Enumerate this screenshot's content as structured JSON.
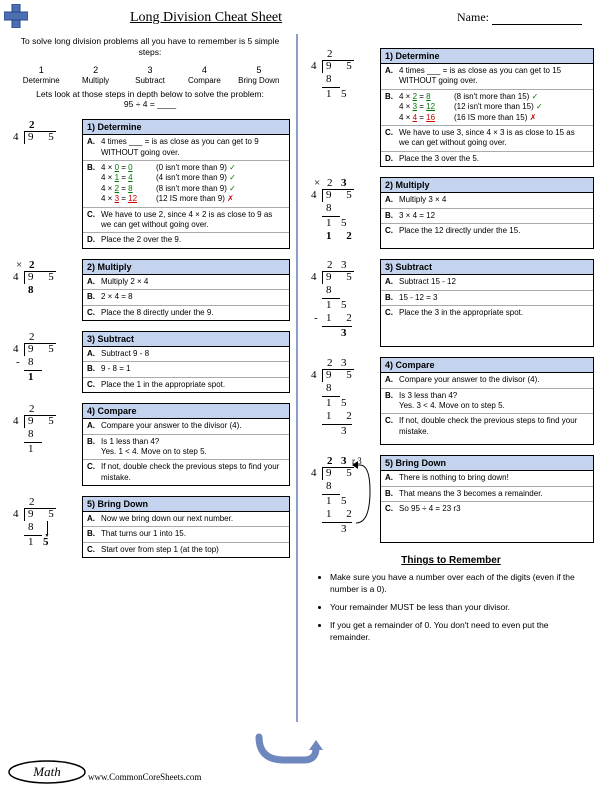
{
  "header": {
    "title": "Long Division Cheat Sheet",
    "name_label": "Name:"
  },
  "intro": {
    "line1": "To solve long division problems all you have to remember is 5 simple steps:",
    "steps": [
      {
        "n": "1",
        "t": "Determine"
      },
      {
        "n": "2",
        "t": "Multiply"
      },
      {
        "n": "3",
        "t": "Subtract"
      },
      {
        "n": "4",
        "t": "Compare"
      },
      {
        "n": "5",
        "t": "Bring Down"
      }
    ],
    "example_prefix": "Lets look at those steps in depth below to solve the problem:",
    "example_problem": "95 ÷ 4 = ____"
  },
  "left_steps": [
    {
      "hdr": "1) Determine",
      "lines": [
        {
          "lbl": "A.",
          "txt": "4 times ___ = is as close as you can get to 9 WITHOUT going over."
        },
        {
          "lbl": "B.",
          "html": [
            {
              "lhs": "4 × ",
              "u": "0",
              "mid": " = ",
              "v": "0",
              "note": "(0 isn't more than 9)",
              "cls": "ok",
              "mark": "✓"
            },
            {
              "lhs": "4 × ",
              "u": "1",
              "mid": " = ",
              "v": "4",
              "note": "(4 isn't more than 9)",
              "cls": "ok",
              "mark": "✓"
            },
            {
              "lhs": "4 × ",
              "u": "2",
              "mid": " = ",
              "v": "8",
              "note": "(8 isn't more than 9)",
              "cls": "ok",
              "mark": "✓"
            },
            {
              "lhs": "4 × ",
              "u": "3",
              "mid": " = ",
              "v": "12",
              "note": "(12 IS more than 9)",
              "cls": "bad",
              "mark": "✗"
            }
          ]
        },
        {
          "lbl": "C.",
          "txt": "We have to use 2, since 4 × 2 is as close to 9 as we can get without going over."
        },
        {
          "lbl": "D.",
          "txt": "Place the 2 over the 9."
        }
      ]
    },
    {
      "hdr": "2) Multiply",
      "lines": [
        {
          "lbl": "A.",
          "txt": "Multiply 2 × 4"
        },
        {
          "lbl": "B.",
          "txt": "2 × 4 = 8"
        },
        {
          "lbl": "C.",
          "txt": "Place the 8 directly under the 9."
        }
      ]
    },
    {
      "hdr": "3) Subtract",
      "lines": [
        {
          "lbl": "A.",
          "txt": "Subtract 9 - 8"
        },
        {
          "lbl": "B.",
          "txt": "9 - 8 = 1"
        },
        {
          "lbl": "C.",
          "txt": "Place the 1 in the appropriate spot."
        }
      ]
    },
    {
      "hdr": "4) Compare",
      "lines": [
        {
          "lbl": "A.",
          "txt": "Compare your answer to the divisor (4)."
        },
        {
          "lbl": "B.",
          "txt": "Is 1 less than 4?\nYes. 1 < 4. Move on to step 5."
        },
        {
          "lbl": "C.",
          "txt": "If not, double check the previous steps to find your mistake."
        }
      ]
    },
    {
      "hdr": "5) Bring Down",
      "lines": [
        {
          "lbl": "A.",
          "txt": "Now we bring down our next number."
        },
        {
          "lbl": "B.",
          "txt": "That turns our 1 into 15."
        },
        {
          "lbl": "C.",
          "txt": "Start over from step 1 (at the top)"
        }
      ]
    }
  ],
  "right_steps": [
    {
      "hdr": "1) Determine",
      "lines": [
        {
          "lbl": "A.",
          "txt": "4 times ___ = is as close as you can get to 15 WITHOUT going over."
        },
        {
          "lbl": "B.",
          "html": [
            {
              "lhs": "4 × ",
              "u": "2",
              "mid": " = ",
              "v": "8",
              "note": "(8 isn't more than 15)",
              "cls": "ok",
              "mark": "✓"
            },
            {
              "lhs": "4 × ",
              "u": "3",
              "mid": " = ",
              "v": "12",
              "note": "(12 isn't more than 15)",
              "cls": "ok",
              "mark": "✓"
            },
            {
              "lhs": "4 × ",
              "u": "4",
              "mid": " = ",
              "v": "16",
              "note": "(16 IS more than 15)",
              "cls": "bad",
              "mark": "✗"
            }
          ]
        },
        {
          "lbl": "C.",
          "txt": "We have to use 3, since 4 × 3 is as close to 15 as we can get without going over."
        },
        {
          "lbl": "D.",
          "txt": "Place the 3 over the 5."
        }
      ]
    },
    {
      "hdr": "2) Multiply",
      "lines": [
        {
          "lbl": "A.",
          "txt": "Multiply 3 × 4"
        },
        {
          "lbl": "B.",
          "txt": "3 × 4 = 12"
        },
        {
          "lbl": "C.",
          "txt": "Place the 12 directly under the 15."
        }
      ]
    },
    {
      "hdr": "3) Subtract",
      "lines": [
        {
          "lbl": "A.",
          "txt": "Subtract 15 - 12"
        },
        {
          "lbl": "B.",
          "txt": "15 - 12 = 3"
        },
        {
          "lbl": "C.",
          "txt": "Place the 3 in the appropriate spot."
        }
      ]
    },
    {
      "hdr": "4) Compare",
      "lines": [
        {
          "lbl": "A.",
          "txt": "Compare your answer to the divisor (4)."
        },
        {
          "lbl": "B.",
          "txt": "Is 3 less than 4?\nYes. 3 < 4. Move on to step 5."
        },
        {
          "lbl": "C.",
          "txt": "If not, double check the previous steps to find your mistake."
        }
      ]
    },
    {
      "hdr": "5) Bring Down",
      "lines": [
        {
          "lbl": "A.",
          "txt": "There is nothing to bring down!"
        },
        {
          "lbl": "B.",
          "txt": "That means the 3 becomes a remainder."
        },
        {
          "lbl": "C.",
          "txt": "So 95 ÷ 4 = 23 r3"
        }
      ]
    }
  ],
  "remember": {
    "heading": "Things to Remember",
    "items": [
      "Make sure you have a number over each of the digits (even if the number is a 0).",
      "Your remainder MUST be less than your divisor.",
      "If you get a remainder of 0. You don't need to even put the remainder."
    ]
  },
  "footer": {
    "math_label": "Math",
    "url": "www.CommonCoreSheets.com"
  }
}
